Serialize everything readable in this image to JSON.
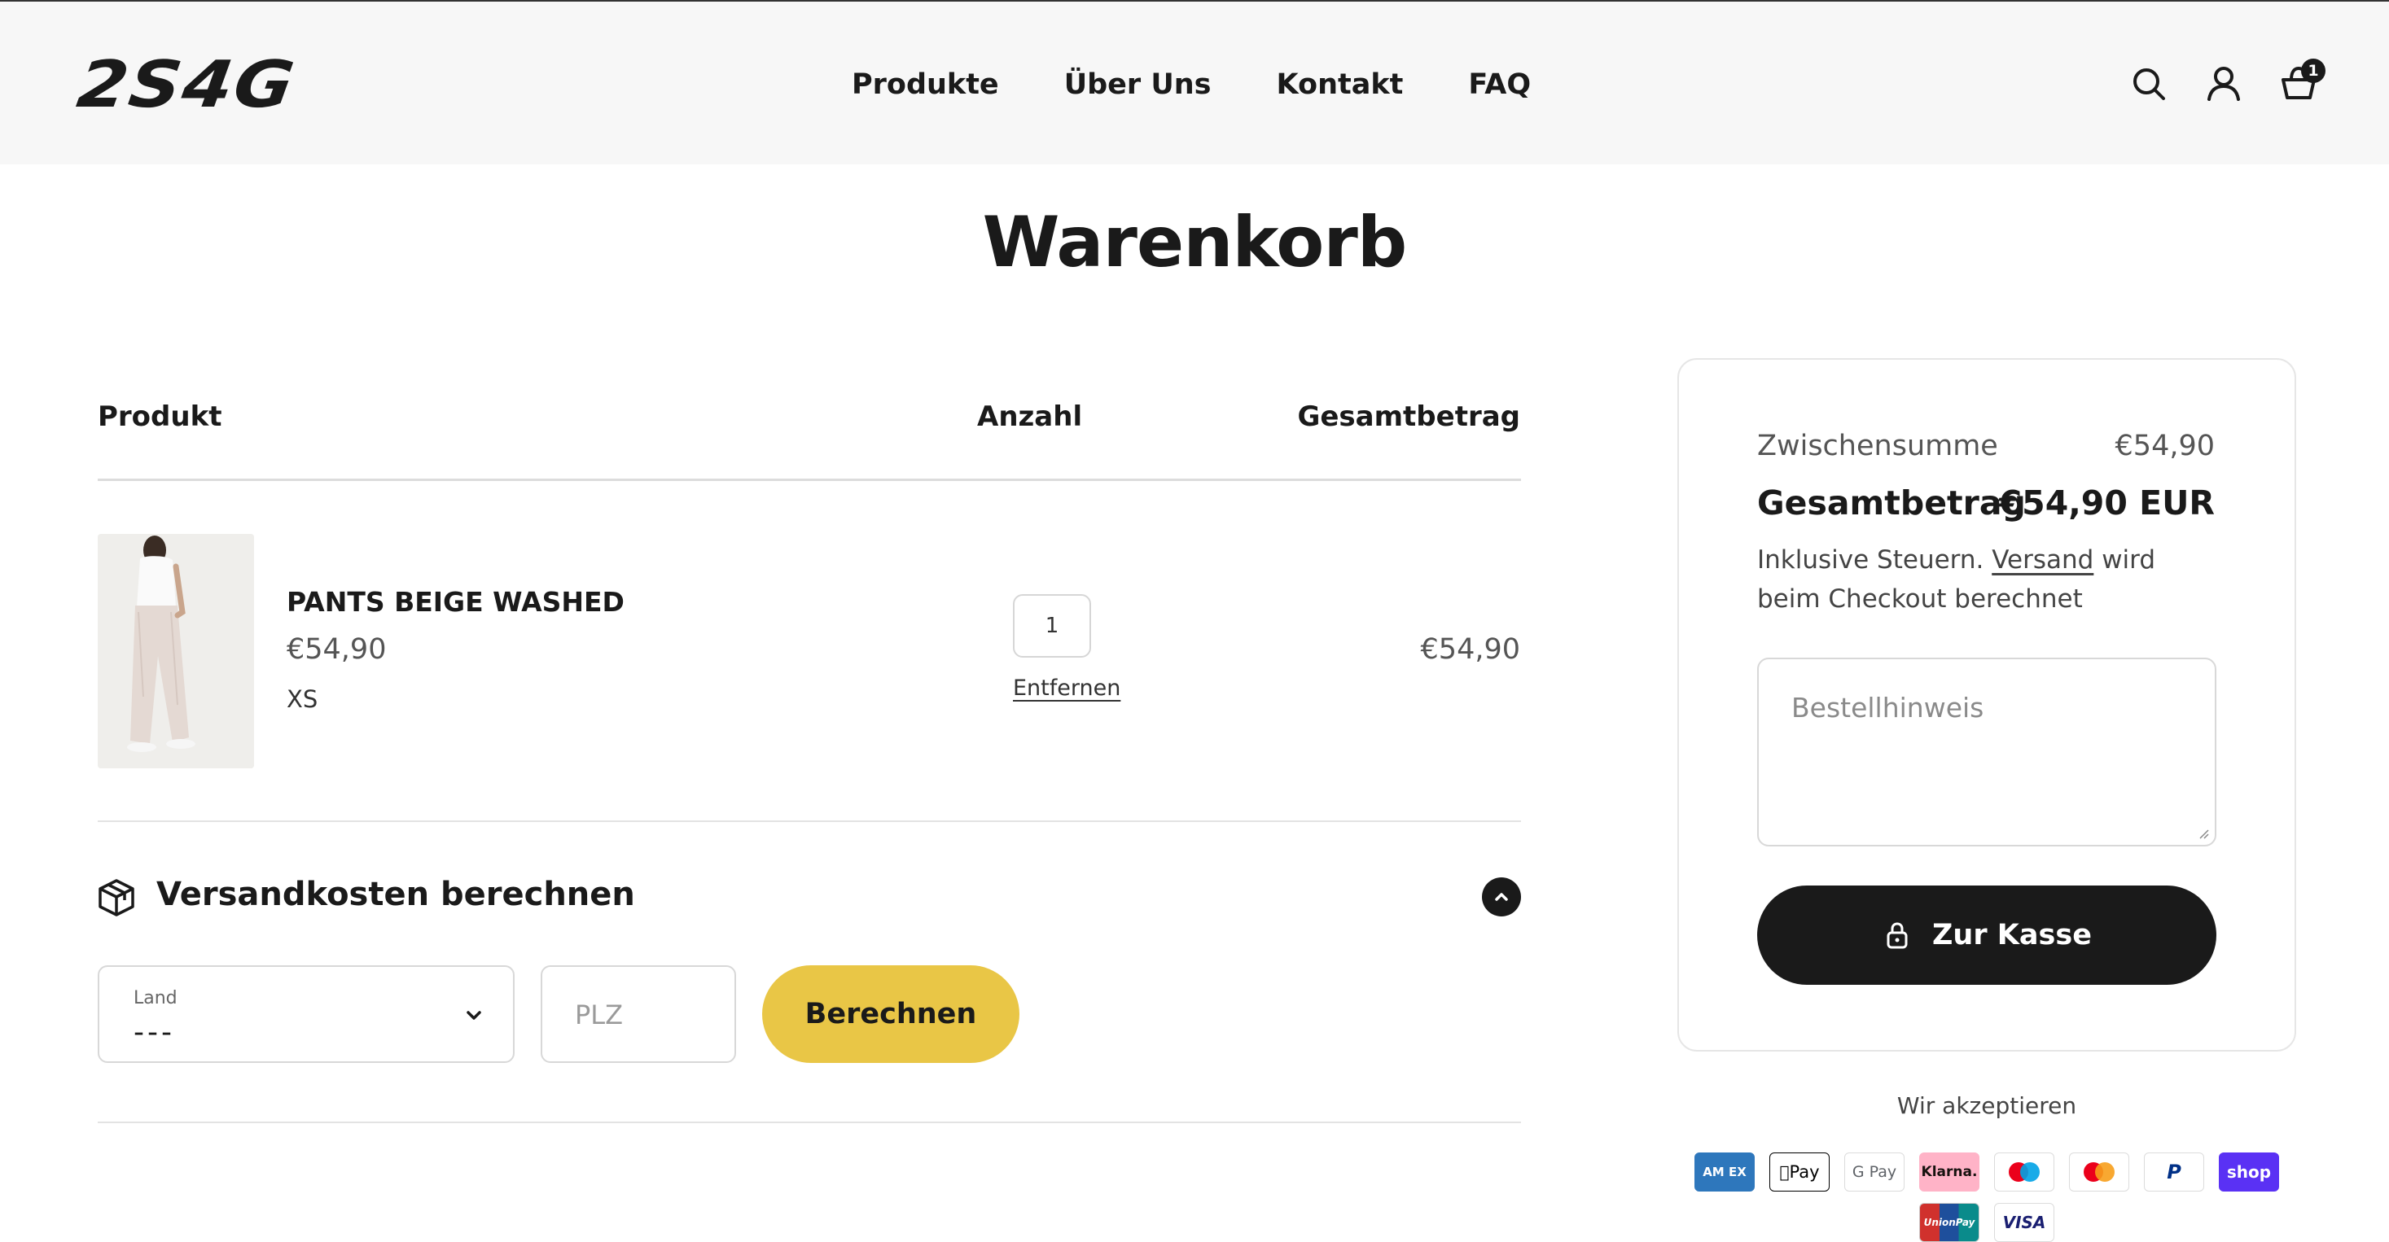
{
  "brand": {
    "logo_text": "2S4G"
  },
  "nav": {
    "items": [
      {
        "label": "Produkte"
      },
      {
        "label": "Über Uns"
      },
      {
        "label": "Kontakt"
      },
      {
        "label": "FAQ"
      }
    ]
  },
  "header_icons": {
    "search": "search-icon",
    "account": "user-icon",
    "cart": "shopping-bag-icon",
    "cart_count": "1"
  },
  "page": {
    "title": "Warenkorb"
  },
  "table": {
    "headers": {
      "product": "Produkt",
      "quantity": "Anzahl",
      "total": "Gesamtbetrag"
    }
  },
  "line_items": [
    {
      "name": "PANTS BEIGE WASHED",
      "price": "€54,90",
      "variant": "XS",
      "quantity": "1",
      "remove_label": "Entfernen",
      "line_total": "€54,90"
    }
  ],
  "shipping": {
    "title": "Versandkosten berechnen",
    "country_label": "Land",
    "country_value": "---",
    "zip_placeholder": "PLZ",
    "button_label": "Berechnen"
  },
  "summary": {
    "subtotal_label": "Zwischensumme",
    "subtotal_value": "€54,90",
    "total_label": "Gesamtbetrag",
    "total_value": "€54,90 EUR",
    "tax_note_prefix": "Inklusive Steuern.",
    "tax_note_link": "Versand",
    "tax_note_suffix": "wird beim Checkout berechnet",
    "order_note_placeholder": "Bestellhinweis",
    "checkout_label": "Zur Kasse"
  },
  "payments": {
    "title": "Wir akzeptieren",
    "methods": [
      {
        "name": "American Express",
        "text": "AM EX",
        "bg": "#2e77bc",
        "fg": "#ffffff"
      },
      {
        "name": "Apple Pay",
        "text": "Pay",
        "bg": "#ffffff",
        "fg": "#000000"
      },
      {
        "name": "Google Pay",
        "text": "G Pay",
        "bg": "#ffffff",
        "fg": "#5f6368"
      },
      {
        "name": "Klarna",
        "text": "Klarna.",
        "bg": "#ffb3c7",
        "fg": "#17120f"
      },
      {
        "name": "Maestro",
        "text": "",
        "bg": "#ffffff",
        "fg": "#000000"
      },
      {
        "name": "Mastercard",
        "text": "",
        "bg": "#ffffff",
        "fg": "#000000"
      },
      {
        "name": "PayPal",
        "text": "P",
        "bg": "#ffffff",
        "fg": "#003087"
      },
      {
        "name": "Shop Pay",
        "text": "shop",
        "bg": "#5a31f4",
        "fg": "#ffffff"
      },
      {
        "name": "UnionPay",
        "text": "UnionPay",
        "bg": "#d0312d",
        "fg": "#ffffff"
      },
      {
        "name": "Visa",
        "text": "VISA",
        "bg": "#ffffff",
        "fg": "#1a1f71"
      }
    ]
  },
  "colors": {
    "accent_button": "#e9c646",
    "dark": "#1a1a1a",
    "header_bg": "#f7f7f7"
  }
}
